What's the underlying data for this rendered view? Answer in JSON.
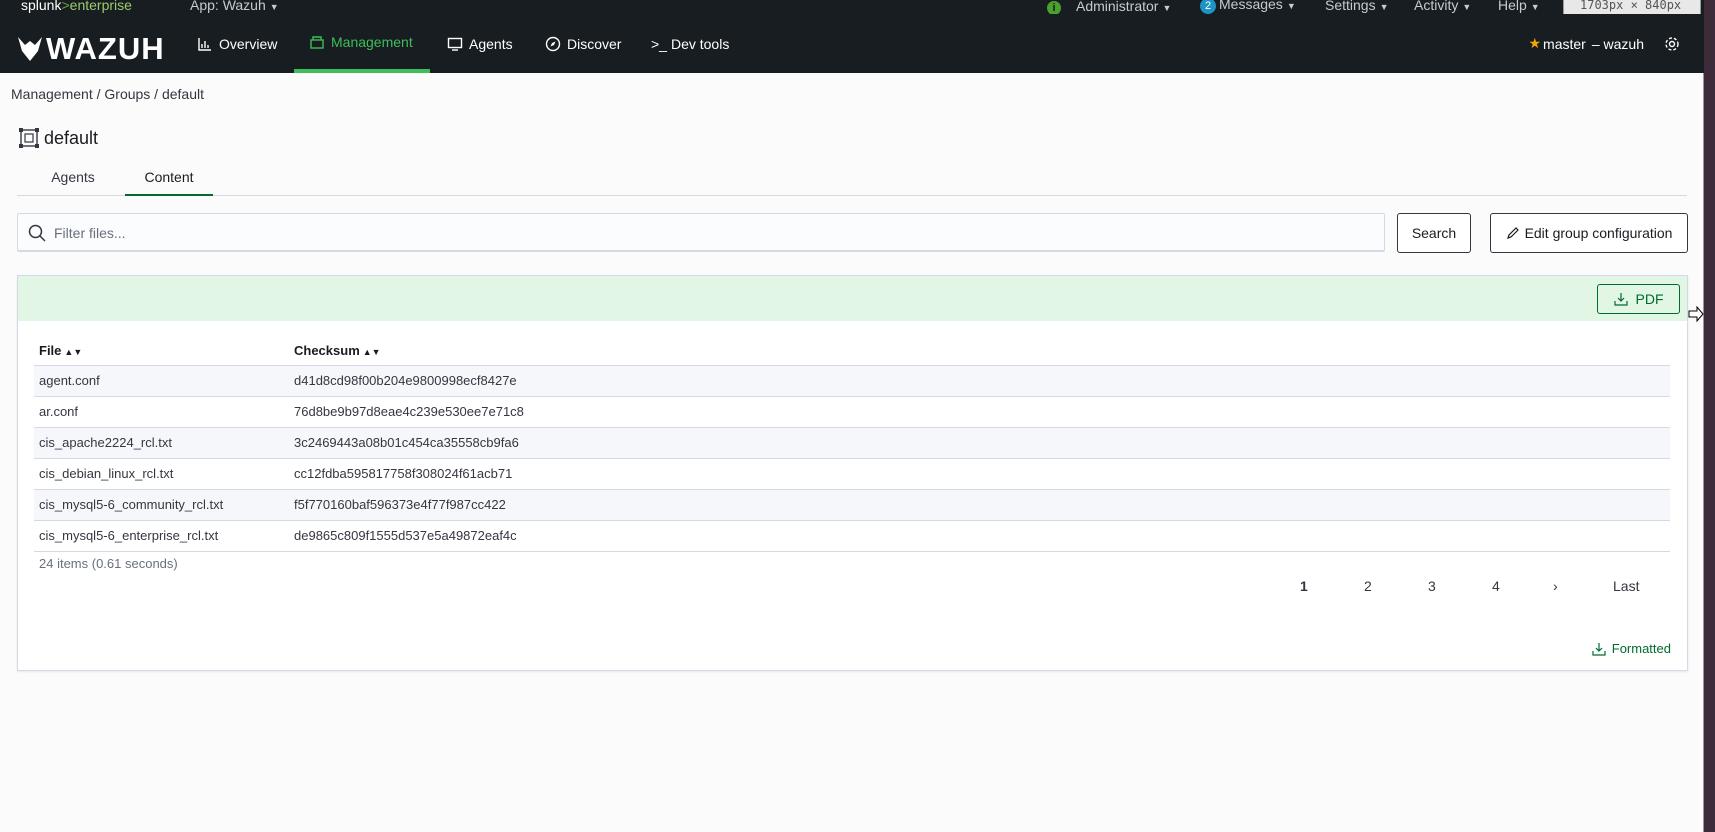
{
  "splunk": {
    "logo_main": "splunk",
    "logo_gt": ">",
    "logo_ent": "enterprise",
    "app": "App: Wazuh",
    "user": "Administrator",
    "messages_count": "2",
    "messages": "Messages",
    "settings": "Settings",
    "activity": "Activity",
    "help": "Help",
    "dimension_overlay": "1703px × 840px"
  },
  "nav": {
    "brand": "WAZUH",
    "items": [
      {
        "label": "Overview",
        "icon": "chart-icon"
      },
      {
        "label": "Management",
        "icon": "management-icon",
        "active": true
      },
      {
        "label": "Agents",
        "icon": "monitor-icon"
      },
      {
        "label": "Discover",
        "icon": "compass-icon"
      },
      {
        "label": "Dev tools",
        "icon": "console-icon"
      }
    ],
    "api_label": "master",
    "api_sep": " – wazuh"
  },
  "breadcrumb": "Management / Groups / default",
  "group_title": "default",
  "tabs": [
    "Agents",
    "Content"
  ],
  "search": {
    "placeholder": "Filter files...",
    "button": "Search"
  },
  "edit_button": "Edit group configuration",
  "pdf_button": "PDF",
  "table": {
    "headers": [
      "File",
      "Checksum"
    ],
    "rows": [
      [
        "agent.conf",
        "d41d8cd98f00b204e9800998ecf8427e"
      ],
      [
        "ar.conf",
        "76d8be9b97d8eae4c239e530ee7e71c8"
      ],
      [
        "cis_apache2224_rcl.txt",
        "3c2469443a08b01c454ca35558cb9fa6"
      ],
      [
        "cis_debian_linux_rcl.txt",
        "cc12fdba595817758f308024f61acb71"
      ],
      [
        "cis_mysql5-6_community_rcl.txt",
        "f5f770160baf596373e4f77f987cc422"
      ],
      [
        "cis_mysql5-6_enterprise_rcl.txt",
        "de9865c809f1555d537e5a49872eaf4c"
      ]
    ]
  },
  "items_count": "24 items (0.61 seconds)",
  "pagination": [
    "1",
    "2",
    "3",
    "4",
    "›",
    "Last"
  ],
  "formatted": "Formatted",
  "colors": {
    "accent": "#3ebd5b",
    "brand_green": "#006b2d",
    "header_bg": "#171d21"
  }
}
